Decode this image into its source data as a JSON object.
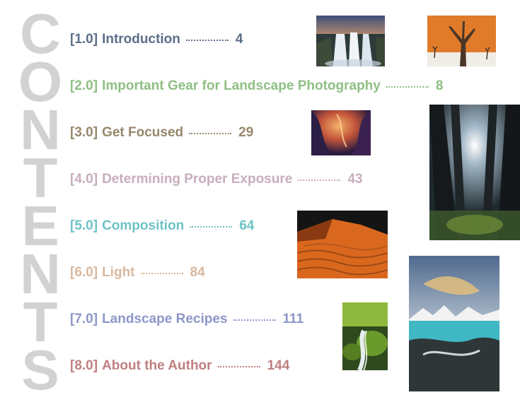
{
  "side_title": [
    "C",
    "O",
    "N",
    "T",
    "E",
    "N",
    "T",
    "S"
  ],
  "entries": [
    {
      "num": "[1.0]",
      "title": "Introduction",
      "page": "4",
      "color": "#5d6e8a"
    },
    {
      "num": "[2.0]",
      "title": "Important Gear for Landscape Photography",
      "page": "8",
      "color": "#8fbf84"
    },
    {
      "num": "[3.0]",
      "title": "Get Focused",
      "page": "29",
      "color": "#97876b"
    },
    {
      "num": "[4.0]",
      "title": "Determining Proper Exposure",
      "page": "43",
      "color": "#c9adbd"
    },
    {
      "num": "[5.0]",
      "title": "Composition",
      "page": "64",
      "color": "#6ec3c6"
    },
    {
      "num": "[6.0]",
      "title": "Light",
      "page": "84",
      "color": "#d8b9a0"
    },
    {
      "num": "[7.0]",
      "title": "Landscape Recipes",
      "page": "111",
      "color": "#8e97c9"
    },
    {
      "num": "[8.0]",
      "title": "About the Author",
      "page": "144",
      "color": "#bf7f80"
    }
  ],
  "photos": [
    {
      "name": "waterfall-photo"
    },
    {
      "name": "dead-tree-dunes-photo"
    },
    {
      "name": "slot-canyon-photo"
    },
    {
      "name": "forest-canopy-photo"
    },
    {
      "name": "sand-dune-photo"
    },
    {
      "name": "mountain-lake-photo"
    },
    {
      "name": "mossy-stream-photo"
    }
  ],
  "colors": {
    "side_title": "#d2d2d2",
    "background": "#ffffff"
  }
}
